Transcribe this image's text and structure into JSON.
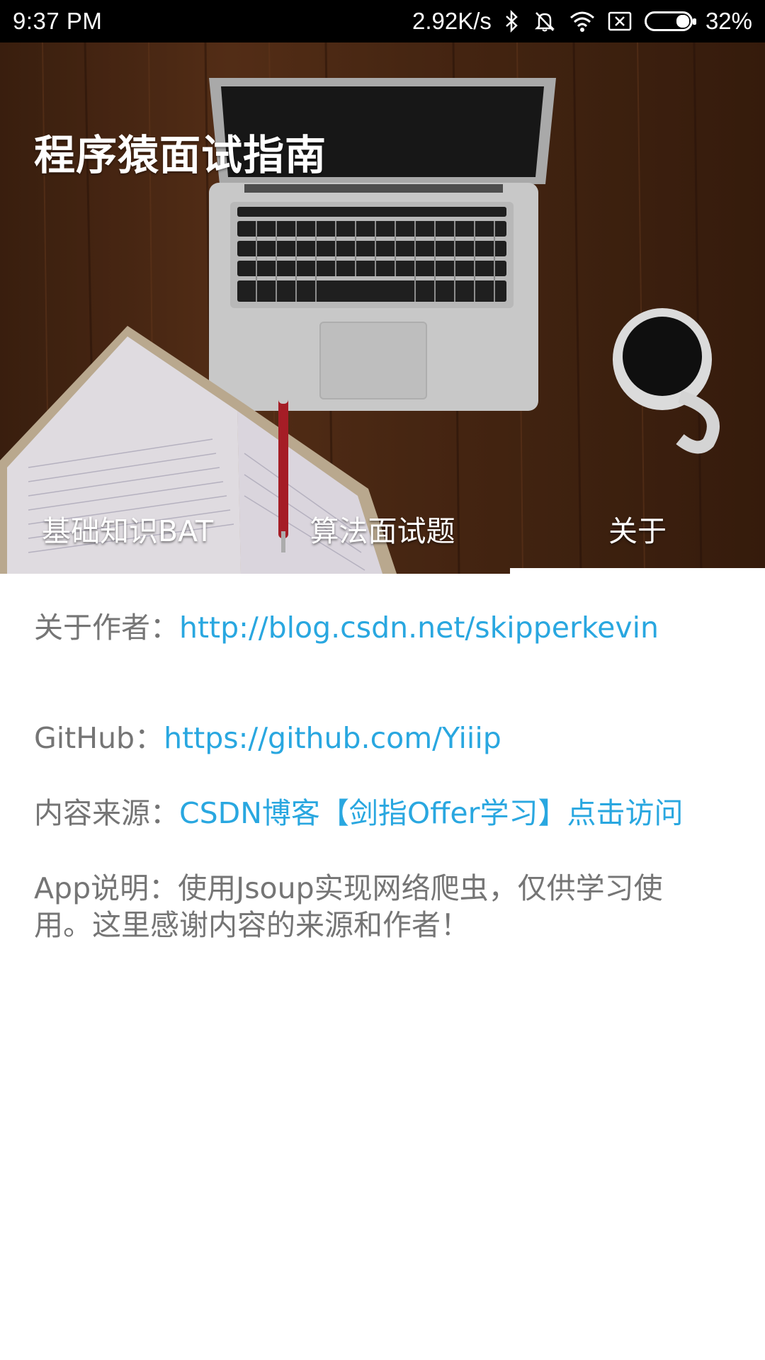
{
  "status_bar": {
    "time": "9:37  PM",
    "speed": "2.92K/s",
    "battery": "32%"
  },
  "app": {
    "title": "程序猿面试指南"
  },
  "tabs": [
    {
      "label": "基础知识BAT"
    },
    {
      "label": "算法面试题"
    },
    {
      "label": "关于"
    }
  ],
  "selected_tab": "关于",
  "about": {
    "author_label": "关于作者：",
    "author_link": "http://blog.csdn.net/skipperkevin",
    "github_label": "GitHub：",
    "github_link": "https://github.com/Yiiip",
    "source_label": "内容来源：",
    "source_link": "CSDN博客【剑指Offer学习】点击访问",
    "app_desc": "App说明：使用Jsoup实现网络爬虫，仅供学习使用。这里感谢内容的来源和作者！"
  },
  "colors": {
    "link": "#29a7e0",
    "text": "#757575",
    "status_bar": "#000000"
  }
}
